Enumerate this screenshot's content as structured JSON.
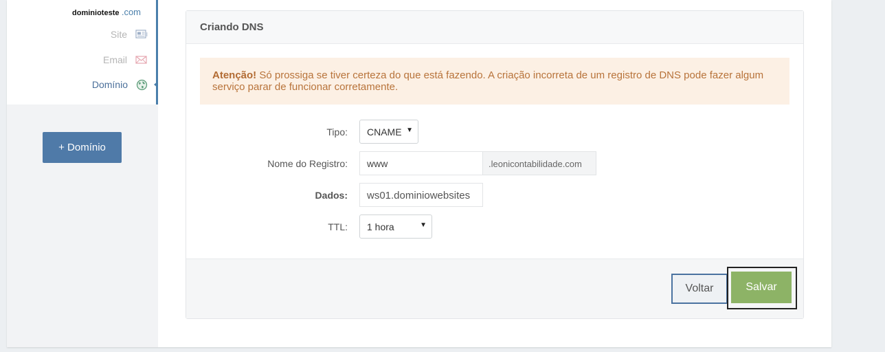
{
  "sidebar": {
    "domain_name": "dominioteste",
    "domain_tld": ".com",
    "items": [
      {
        "label": "Site",
        "icon": "site-icon"
      },
      {
        "label": "Email",
        "icon": "email-icon"
      },
      {
        "label": "Domínio",
        "icon": "globe-icon",
        "active": true
      }
    ],
    "add_button": "+ Domínio"
  },
  "panel": {
    "title": "Criando DNS",
    "alert": {
      "strong": "Atenção!",
      "text": " Só prossiga se tiver certeza do que está fazendo. A criação incorreta de um registro de DNS pode fazer algum serviço parar de funcionar corretamente."
    },
    "form": {
      "tipo_label": "Tipo:",
      "tipo_value": "CNAME",
      "nome_label": "Nome do Registro:",
      "nome_value": "www",
      "nome_suffix": ".leonicontabilidade.com",
      "dados_label": "Dados:",
      "dados_value": "ws01.dominiowebsites",
      "ttl_label": "TTL:",
      "ttl_value": "1 hora"
    },
    "footer": {
      "back_label": "Voltar",
      "save_label": "Salvar"
    }
  },
  "colors": {
    "primary": "#4f7aa8",
    "success": "#8db366",
    "alert_bg": "#fcf0e4",
    "alert_text": "#b8733a"
  }
}
